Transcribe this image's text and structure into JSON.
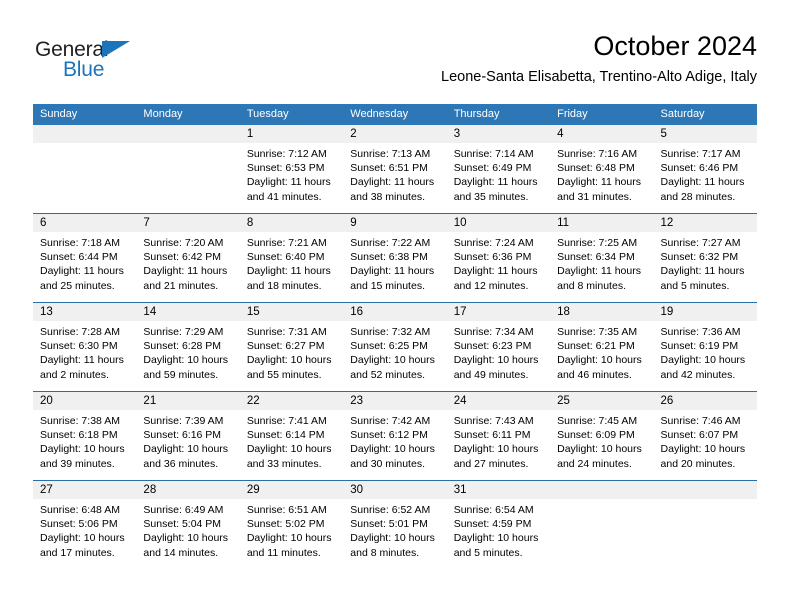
{
  "logo": {
    "word_one": "General",
    "word_two": "Blue",
    "triangle_icon": "blue-triangle-icon",
    "brand_color": "#1c75bc",
    "text_color": "#231f20"
  },
  "header": {
    "title": "October 2024",
    "subtitle": "Leone-Santa Elisabetta, Trentino-Alto Adige, Italy"
  },
  "colors": {
    "header_blue": "#2e77b6",
    "rule_blue": "#2c6ca8",
    "day_band_gray": "#f0f0f0"
  },
  "calendar": {
    "weekdays": [
      "Sunday",
      "Monday",
      "Tuesday",
      "Wednesday",
      "Thursday",
      "Friday",
      "Saturday"
    ],
    "weeks": [
      [
        {
          "day": "",
          "sunrise": "",
          "sunset": "",
          "daylight": "",
          "daylight2": ""
        },
        {
          "day": "",
          "sunrise": "",
          "sunset": "",
          "daylight": "",
          "daylight2": ""
        },
        {
          "day": "1",
          "sunrise": "Sunrise: 7:12 AM",
          "sunset": "Sunset: 6:53 PM",
          "daylight": "Daylight: 11 hours",
          "daylight2": "and 41 minutes."
        },
        {
          "day": "2",
          "sunrise": "Sunrise: 7:13 AM",
          "sunset": "Sunset: 6:51 PM",
          "daylight": "Daylight: 11 hours",
          "daylight2": "and 38 minutes."
        },
        {
          "day": "3",
          "sunrise": "Sunrise: 7:14 AM",
          "sunset": "Sunset: 6:49 PM",
          "daylight": "Daylight: 11 hours",
          "daylight2": "and 35 minutes."
        },
        {
          "day": "4",
          "sunrise": "Sunrise: 7:16 AM",
          "sunset": "Sunset: 6:48 PM",
          "daylight": "Daylight: 11 hours",
          "daylight2": "and 31 minutes."
        },
        {
          "day": "5",
          "sunrise": "Sunrise: 7:17 AM",
          "sunset": "Sunset: 6:46 PM",
          "daylight": "Daylight: 11 hours",
          "daylight2": "and 28 minutes."
        }
      ],
      [
        {
          "day": "6",
          "sunrise": "Sunrise: 7:18 AM",
          "sunset": "Sunset: 6:44 PM",
          "daylight": "Daylight: 11 hours",
          "daylight2": "and 25 minutes."
        },
        {
          "day": "7",
          "sunrise": "Sunrise: 7:20 AM",
          "sunset": "Sunset: 6:42 PM",
          "daylight": "Daylight: 11 hours",
          "daylight2": "and 21 minutes."
        },
        {
          "day": "8",
          "sunrise": "Sunrise: 7:21 AM",
          "sunset": "Sunset: 6:40 PM",
          "daylight": "Daylight: 11 hours",
          "daylight2": "and 18 minutes."
        },
        {
          "day": "9",
          "sunrise": "Sunrise: 7:22 AM",
          "sunset": "Sunset: 6:38 PM",
          "daylight": "Daylight: 11 hours",
          "daylight2": "and 15 minutes."
        },
        {
          "day": "10",
          "sunrise": "Sunrise: 7:24 AM",
          "sunset": "Sunset: 6:36 PM",
          "daylight": "Daylight: 11 hours",
          "daylight2": "and 12 minutes."
        },
        {
          "day": "11",
          "sunrise": "Sunrise: 7:25 AM",
          "sunset": "Sunset: 6:34 PM",
          "daylight": "Daylight: 11 hours",
          "daylight2": "and 8 minutes."
        },
        {
          "day": "12",
          "sunrise": "Sunrise: 7:27 AM",
          "sunset": "Sunset: 6:32 PM",
          "daylight": "Daylight: 11 hours",
          "daylight2": "and 5 minutes."
        }
      ],
      [
        {
          "day": "13",
          "sunrise": "Sunrise: 7:28 AM",
          "sunset": "Sunset: 6:30 PM",
          "daylight": "Daylight: 11 hours",
          "daylight2": "and 2 minutes."
        },
        {
          "day": "14",
          "sunrise": "Sunrise: 7:29 AM",
          "sunset": "Sunset: 6:28 PM",
          "daylight": "Daylight: 10 hours",
          "daylight2": "and 59 minutes."
        },
        {
          "day": "15",
          "sunrise": "Sunrise: 7:31 AM",
          "sunset": "Sunset: 6:27 PM",
          "daylight": "Daylight: 10 hours",
          "daylight2": "and 55 minutes."
        },
        {
          "day": "16",
          "sunrise": "Sunrise: 7:32 AM",
          "sunset": "Sunset: 6:25 PM",
          "daylight": "Daylight: 10 hours",
          "daylight2": "and 52 minutes."
        },
        {
          "day": "17",
          "sunrise": "Sunrise: 7:34 AM",
          "sunset": "Sunset: 6:23 PM",
          "daylight": "Daylight: 10 hours",
          "daylight2": "and 49 minutes."
        },
        {
          "day": "18",
          "sunrise": "Sunrise: 7:35 AM",
          "sunset": "Sunset: 6:21 PM",
          "daylight": "Daylight: 10 hours",
          "daylight2": "and 46 minutes."
        },
        {
          "day": "19",
          "sunrise": "Sunrise: 7:36 AM",
          "sunset": "Sunset: 6:19 PM",
          "daylight": "Daylight: 10 hours",
          "daylight2": "and 42 minutes."
        }
      ],
      [
        {
          "day": "20",
          "sunrise": "Sunrise: 7:38 AM",
          "sunset": "Sunset: 6:18 PM",
          "daylight": "Daylight: 10 hours",
          "daylight2": "and 39 minutes."
        },
        {
          "day": "21",
          "sunrise": "Sunrise: 7:39 AM",
          "sunset": "Sunset: 6:16 PM",
          "daylight": "Daylight: 10 hours",
          "daylight2": "and 36 minutes."
        },
        {
          "day": "22",
          "sunrise": "Sunrise: 7:41 AM",
          "sunset": "Sunset: 6:14 PM",
          "daylight": "Daylight: 10 hours",
          "daylight2": "and 33 minutes."
        },
        {
          "day": "23",
          "sunrise": "Sunrise: 7:42 AM",
          "sunset": "Sunset: 6:12 PM",
          "daylight": "Daylight: 10 hours",
          "daylight2": "and 30 minutes."
        },
        {
          "day": "24",
          "sunrise": "Sunrise: 7:43 AM",
          "sunset": "Sunset: 6:11 PM",
          "daylight": "Daylight: 10 hours",
          "daylight2": "and 27 minutes."
        },
        {
          "day": "25",
          "sunrise": "Sunrise: 7:45 AM",
          "sunset": "Sunset: 6:09 PM",
          "daylight": "Daylight: 10 hours",
          "daylight2": "and 24 minutes."
        },
        {
          "day": "26",
          "sunrise": "Sunrise: 7:46 AM",
          "sunset": "Sunset: 6:07 PM",
          "daylight": "Daylight: 10 hours",
          "daylight2": "and 20 minutes."
        }
      ],
      [
        {
          "day": "27",
          "sunrise": "Sunrise: 6:48 AM",
          "sunset": "Sunset: 5:06 PM",
          "daylight": "Daylight: 10 hours",
          "daylight2": "and 17 minutes."
        },
        {
          "day": "28",
          "sunrise": "Sunrise: 6:49 AM",
          "sunset": "Sunset: 5:04 PM",
          "daylight": "Daylight: 10 hours",
          "daylight2": "and 14 minutes."
        },
        {
          "day": "29",
          "sunrise": "Sunrise: 6:51 AM",
          "sunset": "Sunset: 5:02 PM",
          "daylight": "Daylight: 10 hours",
          "daylight2": "and 11 minutes."
        },
        {
          "day": "30",
          "sunrise": "Sunrise: 6:52 AM",
          "sunset": "Sunset: 5:01 PM",
          "daylight": "Daylight: 10 hours",
          "daylight2": "and 8 minutes."
        },
        {
          "day": "31",
          "sunrise": "Sunrise: 6:54 AM",
          "sunset": "Sunset: 4:59 PM",
          "daylight": "Daylight: 10 hours",
          "daylight2": "and 5 minutes."
        },
        {
          "day": "",
          "sunrise": "",
          "sunset": "",
          "daylight": "",
          "daylight2": ""
        },
        {
          "day": "",
          "sunrise": "",
          "sunset": "",
          "daylight": "",
          "daylight2": ""
        }
      ]
    ]
  }
}
